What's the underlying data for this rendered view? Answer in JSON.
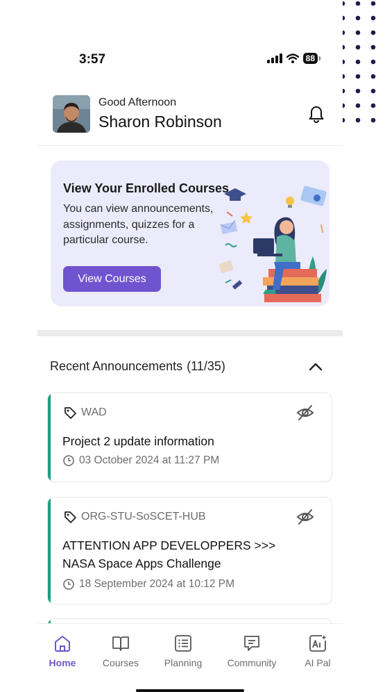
{
  "status_bar": {
    "time": "3:57",
    "battery": "88"
  },
  "header": {
    "greeting": "Good Afternoon",
    "user_name": "Sharon Robinson"
  },
  "banner": {
    "title": "View Your Enrolled Courses",
    "description": "You can view announcements, assignments, quizzes for a particular course.",
    "button_label": "View Courses"
  },
  "announcements": {
    "title": "Recent Announcements",
    "count": "(11/35)",
    "items": [
      {
        "tag": "WAD",
        "subject": "Project 2 update information",
        "date": "03 October 2024 at 11:27 PM"
      },
      {
        "tag": "ORG-STU-SoSCET-HUB",
        "subject": "ATTENTION APP DEVELOPPERS >>> NASA Space Apps Challenge",
        "date": "18 September 2024 at 10:12 PM"
      }
    ]
  },
  "tabs": [
    {
      "label": "Home",
      "icon": "home-icon",
      "active": true
    },
    {
      "label": "Courses",
      "icon": "book-icon",
      "active": false
    },
    {
      "label": "Planning",
      "icon": "list-icon",
      "active": false
    },
    {
      "label": "Community",
      "icon": "chat-icon",
      "active": false
    },
    {
      "label": "AI Pal",
      "icon": "ai-icon",
      "active": false
    }
  ],
  "colors": {
    "accent": "#7054cf",
    "announcement_bar": "#13a17d",
    "banner_bg": "#ebebfb",
    "dots": "#1b1f4b"
  }
}
